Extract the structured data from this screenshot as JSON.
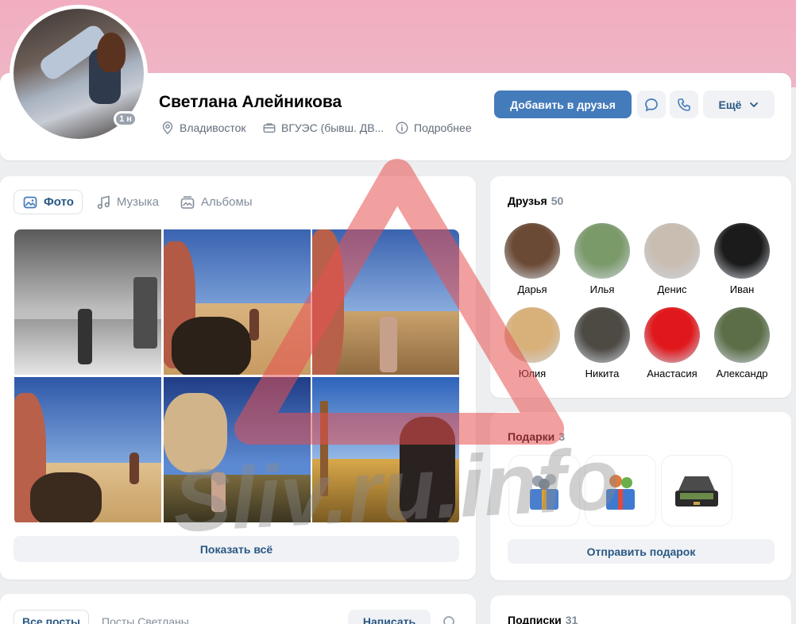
{
  "profile": {
    "name": "Светлана Алейникова",
    "online_badge": "1 н",
    "city": "Владивосток",
    "education": "ВГУЭС (бывш. ДВ...",
    "details_link": "Подробнее"
  },
  "actions": {
    "add_friend": "Добавить в друзья",
    "more": "Ещё"
  },
  "media_tabs": [
    {
      "label": "Фото",
      "icon": "photo-icon",
      "active": true
    },
    {
      "label": "Музыка",
      "icon": "music-icon",
      "active": false
    },
    {
      "label": "Альбомы",
      "icon": "albums-icon",
      "active": false
    }
  ],
  "photos_show_all": "Показать всё",
  "friends": {
    "title": "Друзья",
    "count": "50",
    "items": [
      {
        "name": "Дарья",
        "color": "#6b4a35"
      },
      {
        "name": "Илья",
        "color": "#7b9a6a"
      },
      {
        "name": "Денис",
        "color": "#c9bdb2"
      },
      {
        "name": "Иван",
        "color": "#1b1b1b"
      },
      {
        "name": "Юлия",
        "color": "#d8b07a"
      },
      {
        "name": "Никита",
        "color": "#4d4a44"
      },
      {
        "name": "Анастасия",
        "color": "#e0181c"
      },
      {
        "name": "Александр",
        "color": "#5c6e48"
      }
    ]
  },
  "gifts": {
    "title": "Подарки",
    "count": "3",
    "send": "Отправить подарок"
  },
  "posts": {
    "tab_all": "Все посты",
    "tab_own": "Посты Светланы",
    "write": "Написать"
  },
  "subscriptions": {
    "title": "Подписки",
    "count": "31"
  },
  "watermark_text": "Sliv.ru.info",
  "colors": {
    "accent": "#447bba",
    "link": "#2a5885",
    "cover": "#f2aec0"
  }
}
